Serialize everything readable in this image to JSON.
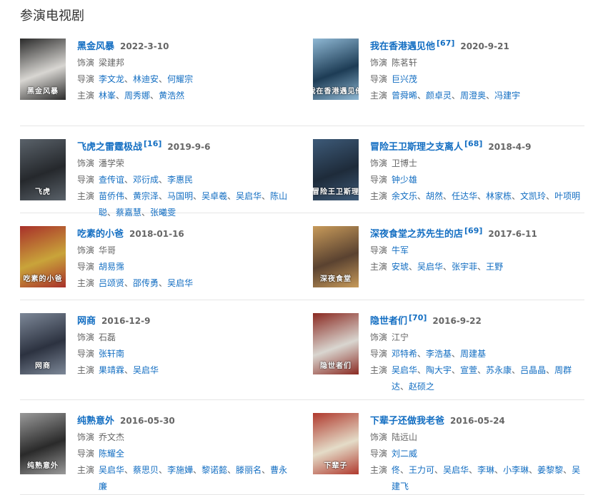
{
  "section_title": "参演电视剧",
  "labels": {
    "role": "饰演",
    "director": "导演",
    "cast": "主演"
  },
  "items": [
    {
      "title": "黑金风暴",
      "ref": "",
      "date": "2022-3-10",
      "role": "梁建邦",
      "directors": [
        "李文龙",
        "林迪安",
        "何耀宗"
      ],
      "cast": [
        "林峯",
        "周秀娜",
        "黄浩然"
      ],
      "poster": {
        "bg": "#d8d6d2",
        "fg": "#2a2a2a",
        "cap": "黑金风暴"
      }
    },
    {
      "title": "我在香港遇见他",
      "ref": "[67]",
      "date": "2020-9-21",
      "role": "陈茗轩",
      "directors": [
        "巨兴茂"
      ],
      "cast": [
        "曾舜晞",
        "颜卓灵",
        "周澄奥",
        "冯建宇"
      ],
      "poster": {
        "bg": "#1d3c55",
        "fg": "#8fb8d4",
        "cap": "我在香港遇见他"
      }
    },
    {
      "title": "飞虎之雷霆极战",
      "ref": "[16]",
      "date": "2019-9-6",
      "role": "潘学荣",
      "directors": [
        "查传谊",
        "邓衍成",
        "李惠民"
      ],
      "cast": [
        "苗侨伟",
        "黄宗泽",
        "马国明",
        "吴卓羲",
        "吴启华",
        "陈山聪",
        "蔡嘉慧",
        "张曦雯"
      ],
      "poster": {
        "bg": "#25282c",
        "fg": "#5a626a",
        "cap": "飞虎"
      }
    },
    {
      "title": "冒险王卫斯理之支离人",
      "ref": "[68]",
      "date": "2018-4-9",
      "role": "卫博士",
      "directors": [
        "钟少雄"
      ],
      "cast": [
        "余文乐",
        "胡然",
        "任达华",
        "林家栋",
        "文凯玲",
        "叶项明"
      ],
      "poster": {
        "bg": "#1e2b3a",
        "fg": "#3d5a78",
        "cap": "冒险王卫斯理"
      }
    },
    {
      "title": "吃素的小爸",
      "ref": "",
      "date": "2018-01-16",
      "role": "华哥",
      "directors": [
        "胡易霈"
      ],
      "cast": [
        "吕颂贤",
        "邵传勇",
        "吴启华"
      ],
      "poster": {
        "bg": "#c9a43a",
        "fg": "#a8302a",
        "cap": "吃素的小爸"
      }
    },
    {
      "title": "深夜食堂之苏先生的店",
      "ref": "[69]",
      "date": "2017-6-11",
      "role": "",
      "directors": [
        "牛军"
      ],
      "cast": [
        "安琥",
        "吴启华",
        "张宇菲",
        "王野"
      ],
      "poster": {
        "bg": "#5a4230",
        "fg": "#c79a5a",
        "cap": "深夜食堂"
      }
    },
    {
      "title": "网商",
      "ref": "",
      "date": "2016-12-9",
      "role": "石磊",
      "directors": [
        "张轩南"
      ],
      "cast": [
        "果靖霖",
        "吴启华"
      ],
      "poster": {
        "bg": "#2c3240",
        "fg": "#7d8898",
        "cap": "网商"
      }
    },
    {
      "title": "隐世者们",
      "ref": "[70]",
      "date": "2016-9-22",
      "role": "江宁",
      "directors": [
        "邓特希",
        "李浩基",
        "周建基"
      ],
      "cast": [
        "吴启华",
        "陶大宇",
        "宣萱",
        "苏永康",
        "吕晶晶",
        "周群达",
        "赵硕之"
      ],
      "poster": {
        "bg": "#d9d6d0",
        "fg": "#8a2a22",
        "cap": "隐世者们"
      }
    },
    {
      "title": "纯熟意外",
      "ref": "",
      "date": "2016-05-30",
      "role": "乔文杰",
      "directors": [
        "陈耀全"
      ],
      "cast": [
        "吴启华",
        "蔡思贝",
        "李施嬅",
        "黎诺懿",
        "滕丽名",
        "曹永廉"
      ],
      "poster": {
        "bg": "#2a2a2a",
        "fg": "#9a9a9a",
        "cap": "纯熟意外"
      }
    },
    {
      "title": "下辈子还做我老爸",
      "ref": "",
      "date": "2016-05-24",
      "role": "陆远山",
      "directors": [
        "刘二威"
      ],
      "cast": [
        "佟",
        "王力可",
        "吴启华",
        "李琳",
        "小李琳",
        "姜黎黎",
        "吴建飞"
      ],
      "poster": {
        "bg": "#e4dcc8",
        "fg": "#b03a2e",
        "cap": "下辈子"
      }
    }
  ]
}
